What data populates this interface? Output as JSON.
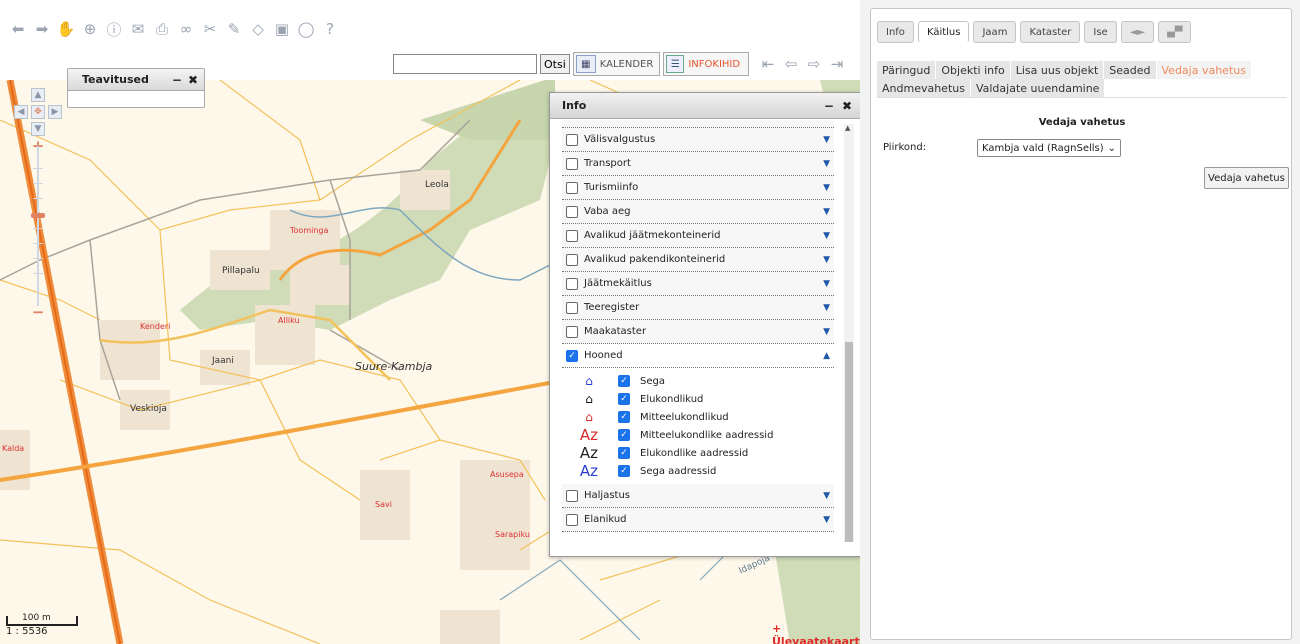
{
  "map": {
    "search": {
      "value": "",
      "placeholder": ""
    },
    "otsi_label": "Otsi",
    "kalender_label": "KALENDER",
    "infokihid_label": "INFOKIHID",
    "scale_distance": "100 m",
    "scale_ratio": "1 : 5536",
    "overview_link": "+ Ülevaatekaart",
    "labels": [
      {
        "id": "suure-kambja",
        "text": "Suure-Kambja"
      },
      {
        "id": "leola",
        "text": "Leola"
      },
      {
        "id": "toominga",
        "text": "Toominga"
      },
      {
        "id": "pillapalu",
        "text": "Pillapalu"
      },
      {
        "id": "alliku",
        "text": "Alliku"
      },
      {
        "id": "kenderi",
        "text": "Kenderi"
      },
      {
        "id": "jaani",
        "text": "Jaani"
      },
      {
        "id": "veskioja",
        "text": "Veskioja"
      },
      {
        "id": "kaida",
        "text": "Kalda"
      },
      {
        "id": "asusepa",
        "text": "Asusepa"
      },
      {
        "id": "savi",
        "text": "Savi"
      },
      {
        "id": "sarapiku",
        "text": "Sarapiku"
      },
      {
        "id": "idapoja",
        "text": "Idapoja"
      },
      {
        "id": "armama",
        "text": "Ärmama"
      }
    ]
  },
  "notifications": {
    "title": "Teavitused"
  },
  "info_window": {
    "title": "Info",
    "layers": [
      {
        "label": "Välisvalgustus",
        "checked": false
      },
      {
        "label": "Transport",
        "checked": false
      },
      {
        "label": "Turismiinfo",
        "checked": false
      },
      {
        "label": "Vaba aeg",
        "checked": false
      },
      {
        "label": "Avalikud jäätmekonteinerid",
        "checked": false
      },
      {
        "label": "Avalikud pakendikonteinerid",
        "checked": false
      },
      {
        "label": "Jäätmekäitlus",
        "checked": false
      },
      {
        "label": "Teeregister",
        "checked": false
      },
      {
        "label": "Maakataster",
        "checked": false
      },
      {
        "label": "Hooned",
        "checked": true
      }
    ],
    "hooned_sublayers": [
      {
        "icon": "house-blue-icon",
        "label": "Sega"
      },
      {
        "icon": "house-black-icon",
        "label": "Elukondlikud"
      },
      {
        "icon": "house-red-icon",
        "label": "Mitteelukondlikud"
      },
      {
        "icon": "az-red-icon",
        "label": "Mitteelukondlike aadressid"
      },
      {
        "icon": "az-black-icon",
        "label": "Elukondlike aadressid"
      },
      {
        "icon": "az-blue-icon",
        "label": "Sega aadressid"
      }
    ],
    "layers_after": [
      {
        "label": "Haljastus",
        "checked": false
      },
      {
        "label": "Elanikud",
        "checked": false
      }
    ]
  },
  "right_panel": {
    "tabs": [
      "Info",
      "Käitlus",
      "Jaam",
      "Kataster",
      "Ise",
      "◄►",
      "▄▀"
    ],
    "active_tab": "Käitlus",
    "subtabs": [
      "Päringud",
      "Objekti info",
      "Lisa uus objekt",
      "Seaded",
      "Vedaja vahetus",
      "Andmevahetus",
      "Valdajate uuendamine"
    ],
    "active_subtab": "Vedaja vahetus",
    "form_title": "Vedaja vahetus",
    "piirkond_label": "Piirkond:",
    "piirkond_value": "Kambja vald (RagnSells)",
    "submit_label": "Vedaja vahetus"
  }
}
